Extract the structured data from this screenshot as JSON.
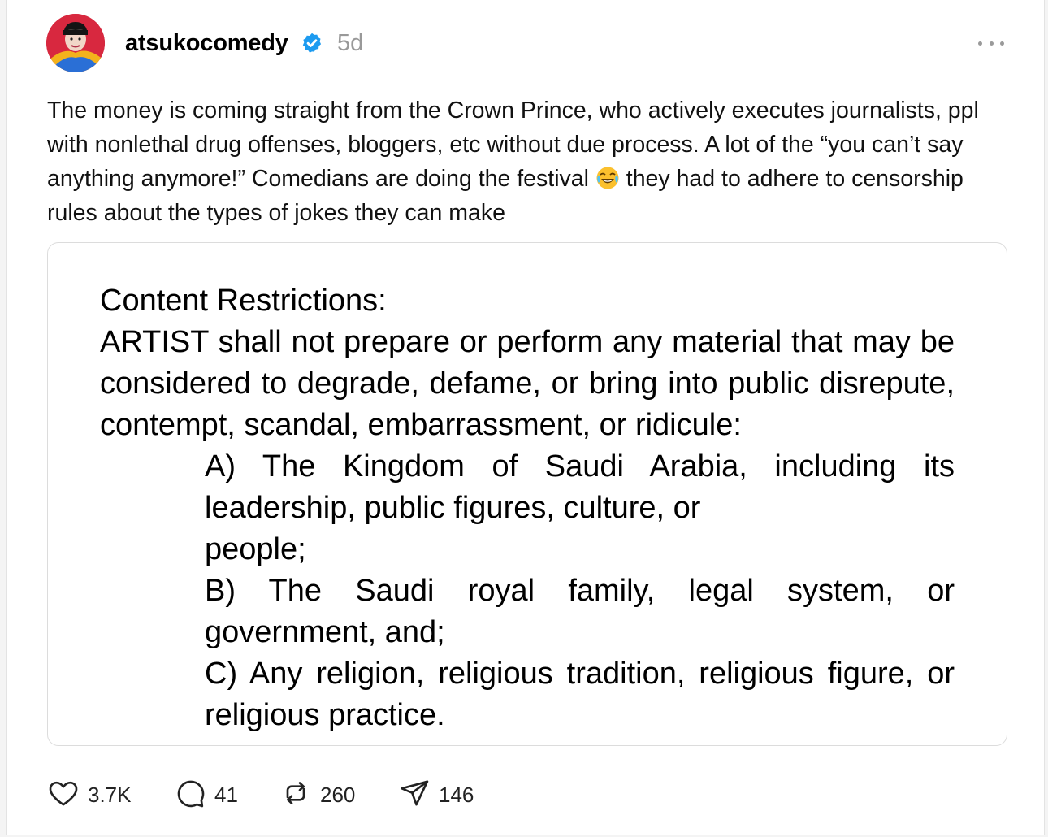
{
  "post": {
    "username": "atsukocomedy",
    "timestamp": "5d",
    "text_part1": "The money is coming straight from the Crown Prince, who actively executes journalists, ppl with nonlethal drug offenses, bloggers, etc without due process. A lot of the “you can’t say anything anymore!” Comedians are doing the festival ",
    "emoji": "😂",
    "text_part2": " they had to adhere to censorship rules about the types of jokes they can make"
  },
  "document": {
    "heading": "Content Restrictions:",
    "intro": "ARTIST shall not prepare or perform any material that may be considered to degrade, defame, or bring into public disrepute, contempt, scandal, embarrassment, or ridicule:",
    "item_a_line1": "A) The Kingdom of Saudi Arabia, including its leadership, public figures, culture, or",
    "item_a_line2": "people;",
    "item_b": "B) The Saudi royal family, legal system, or government, and;",
    "item_c": "C) Any religion, religious tradition, religious figure, or religious practice."
  },
  "actions": {
    "likes": "3.7K",
    "replies": "41",
    "reposts": "260",
    "shares": "146"
  },
  "colors": {
    "verified": "#1d9bf0",
    "muted": "#999999"
  }
}
